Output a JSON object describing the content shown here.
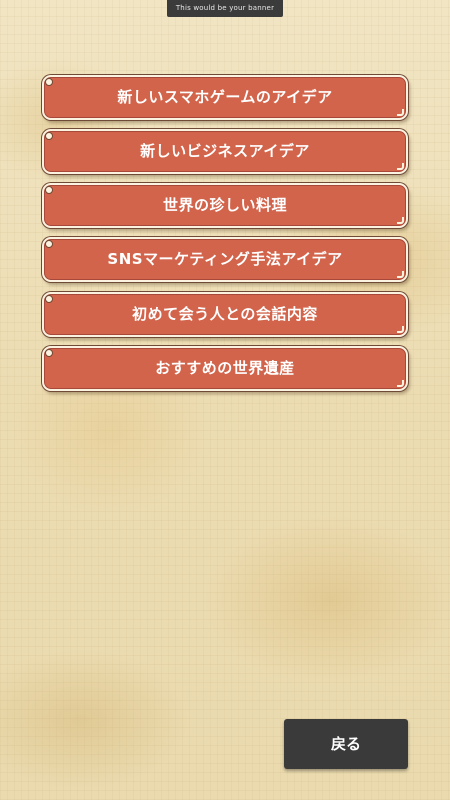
{
  "banner": {
    "text": "This would be your banner"
  },
  "menu": {
    "items": [
      {
        "label": "新しいスマホゲームのアイデア"
      },
      {
        "label": "新しいビジネスアイデア"
      },
      {
        "label": "世界の珍しい料理"
      },
      {
        "label": "SNSマーケティング手法アイデア"
      },
      {
        "label": "初めて会う人との会話内容"
      },
      {
        "label": "おすすめの世界遺産"
      }
    ]
  },
  "footer": {
    "back_label": "戻る"
  },
  "colors": {
    "button_fill": "#d2644b",
    "button_border": "#fbf3e0",
    "button_outline": "#6f4a36",
    "back_button": "#3a3a3a",
    "banner": "#3b3b3b",
    "parchment": "#efe2bd"
  }
}
